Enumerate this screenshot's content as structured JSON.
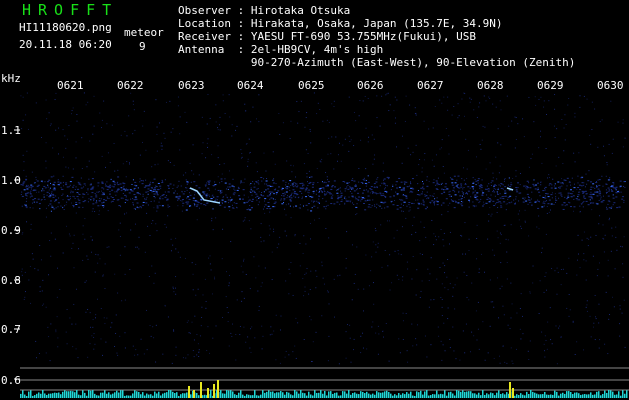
{
  "header": {
    "app_title": "HROFFT",
    "filename": "HI11180620.png",
    "datetime": "20.11.18 06:20",
    "meteor_label": "meteor",
    "meteor_count": "9"
  },
  "station": {
    "observer": "Observer : Hirotaka Otsuka",
    "location": "Location : Hirakata, Osaka, Japan (135.7E, 34.9N)",
    "receiver": "Receiver : YAESU FT-690 53.755MHz(Fukui), USB",
    "antenna": "Antenna  : 2el-HB9CV, 4m's high",
    "antenna2": "           90-270-Azimuth (East-West), 90-Elevation (Zenith)"
  },
  "axis": {
    "y_label": "kHz",
    "y_ticks": [
      "1.1",
      "1.0",
      "0.9",
      "0.8",
      "0.7",
      "0.6"
    ],
    "x_ticks": [
      "0621",
      "0622",
      "0623",
      "0624",
      "0625",
      "0626",
      "0627",
      "0628",
      "0629",
      "0630"
    ]
  },
  "colors": {
    "background": "#000000",
    "title": "#18e018",
    "text": "#ffffff",
    "noise": "#1a2a7a",
    "signal": "#3a6cff",
    "echo": "#a0d8ff",
    "histogram": "#20d8d8",
    "histogram_peak": "#e8e820"
  }
}
